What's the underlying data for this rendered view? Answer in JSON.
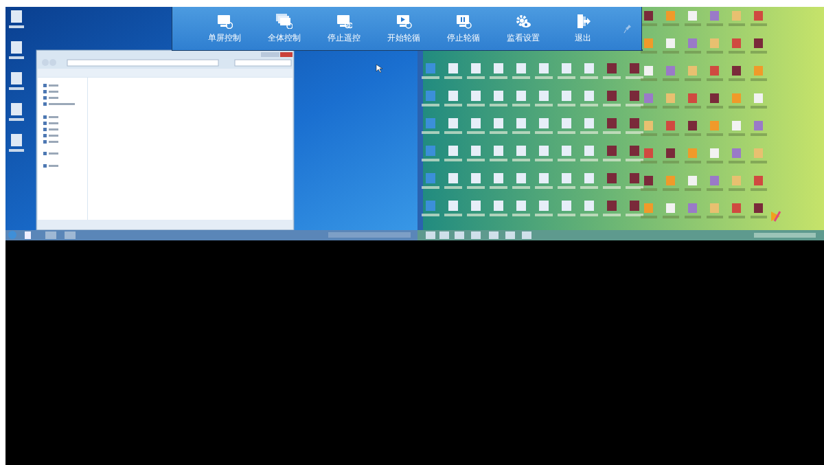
{
  "toolbar": {
    "buttons": [
      {
        "label": "单屏控制",
        "kind": "single"
      },
      {
        "label": "全体控制",
        "kind": "all"
      },
      {
        "label": "停止遥控",
        "kind": "stop"
      },
      {
        "label": "开始轮循",
        "kind": "play"
      },
      {
        "label": "停止轮循",
        "kind": "pause"
      },
      {
        "label": "监看设置",
        "kind": "settings"
      },
      {
        "label": "退出",
        "kind": "exit"
      }
    ]
  },
  "screens": [
    {
      "kind": "explorer"
    },
    {
      "kind": "icons"
    }
  ]
}
